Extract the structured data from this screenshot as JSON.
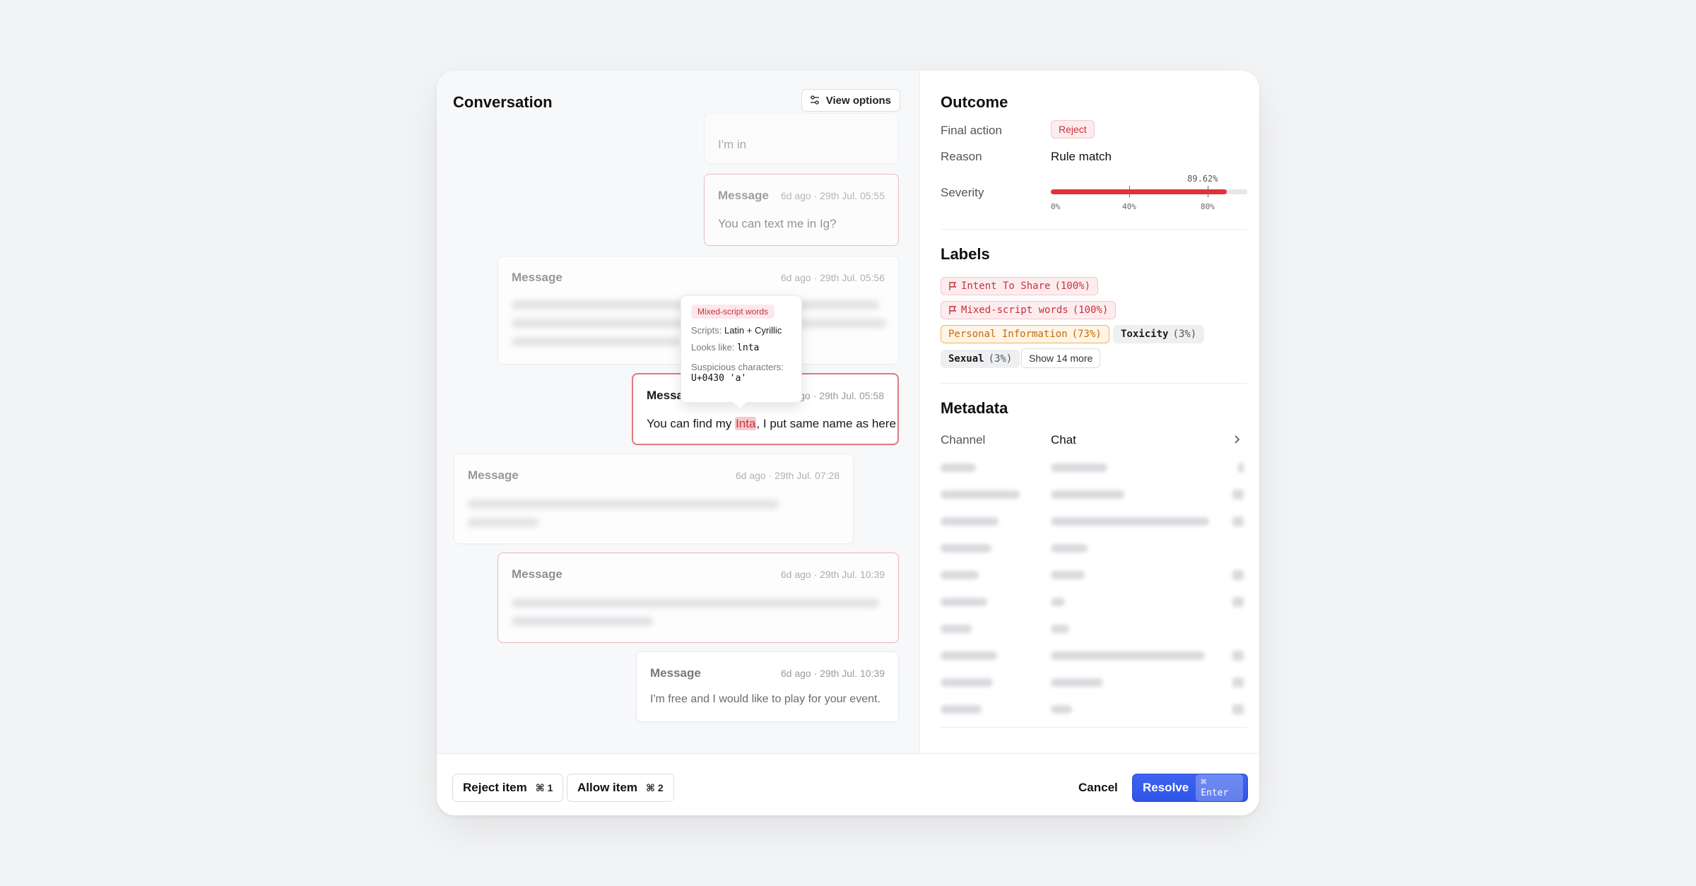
{
  "conversation": {
    "title": "Conversation",
    "view_options_label": "View options",
    "messages": [
      {
        "body": "I'm in"
      },
      {
        "header": "Message",
        "time": "6d ago · 29th Jul. 05:55",
        "body": "You can text me in Ig?"
      },
      {
        "header": "Message",
        "time": "6d ago · 29th Jul. 05:56"
      },
      {
        "header": "Message",
        "time": "6d ago · 29th Jul. 05:58",
        "body_pre": "You can find my ",
        "body_hl": "Inta",
        "body_post": ", I put same name as here"
      },
      {
        "header": "Message",
        "time": "6d ago · 29th Jul. 07:28"
      },
      {
        "header": "Message",
        "time": "6d ago · 29th Jul. 10:39"
      },
      {
        "header": "Message",
        "time": "6d ago · 29th Jul. 10:39",
        "body": "I'm free and I would like to play for your event."
      }
    ]
  },
  "tooltip": {
    "tag": "Mixed-script words",
    "scripts_label": "Scripts:",
    "scripts_value": "Latin + Cyrillic",
    "looks_like_label": "Looks like:",
    "looks_like_value": "lnta",
    "suspicious_label": "Suspicious characters:",
    "suspicious_value": "U+0430 'a'"
  },
  "outcome": {
    "title": "Outcome",
    "final_action_label": "Final action",
    "final_action_value": "Reject",
    "reason_label": "Reason",
    "reason_value": "Rule match",
    "severity_label": "Severity",
    "severity_value": 89.62,
    "severity_display": "89.62%",
    "severity_ticks": [
      "0%",
      "40%",
      "80%"
    ]
  },
  "labels": {
    "title": "Labels",
    "items": [
      {
        "name": "Intent To Share",
        "pct": "(100%)",
        "style": "red",
        "flag": true
      },
      {
        "name": "Mixed-script words",
        "pct": "(100%)",
        "style": "red",
        "flag": true
      },
      {
        "name": "Personal Information",
        "pct": "(73%)",
        "style": "orange"
      },
      {
        "name": "Toxicity",
        "pct": "(3%)",
        "style": "gray"
      },
      {
        "name": "Sexual",
        "pct": "(3%)",
        "style": "gray"
      }
    ],
    "show_more": "Show 14 more"
  },
  "metadata": {
    "title": "Metadata",
    "channel_label": "Channel",
    "channel_value": "Chat"
  },
  "footer": {
    "reject_label": "Reject item",
    "reject_kbd": "⌘ 1",
    "allow_label": "Allow item",
    "allow_kbd": "⌘ 2",
    "cancel_label": "Cancel",
    "resolve_label": "Resolve",
    "resolve_kbd": "⌘ Enter"
  },
  "colors": {
    "accent": "#2f55e6",
    "danger": "#e3303c",
    "warning": "#f0b35a"
  }
}
